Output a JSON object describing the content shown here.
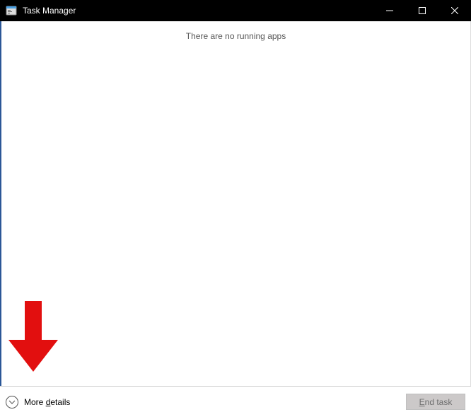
{
  "window": {
    "title": "Task Manager"
  },
  "main": {
    "empty_message": "There are no running apps"
  },
  "footer": {
    "more_details_prefix": "More ",
    "more_details_mnemonic": "d",
    "more_details_suffix": "etails",
    "end_task_mnemonic": "E",
    "end_task_suffix": "nd task"
  },
  "colors": {
    "accent": "#2b5797",
    "annotation": "#e81123"
  }
}
